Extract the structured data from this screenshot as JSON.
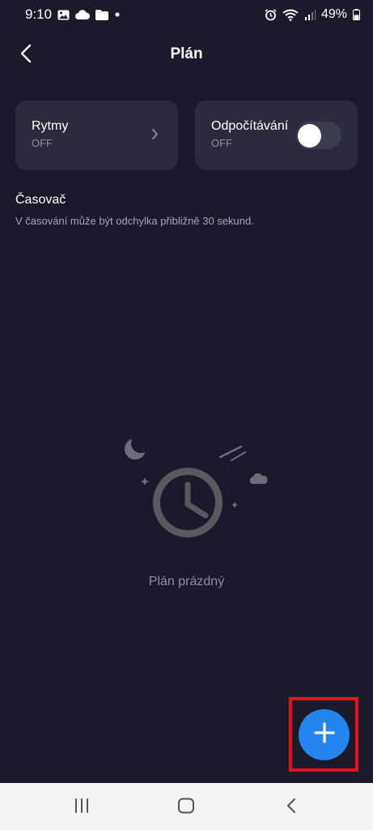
{
  "status_bar": {
    "time": "9:10",
    "battery": "49%",
    "icons_left": [
      "gallery-icon",
      "cloud-icon",
      "folder-icon",
      "dot-icon"
    ],
    "icons_right": [
      "alarm-icon",
      "wifi-icon",
      "signal-icon",
      "battery-icon"
    ]
  },
  "header": {
    "title": "Plán",
    "back_icon": "chevron-left-icon"
  },
  "cards": {
    "rhythms": {
      "title": "Rytmy",
      "status": "OFF"
    },
    "countdown": {
      "title": "Odpočítávání",
      "status": "OFF",
      "toggle_on": false
    }
  },
  "timer_section": {
    "title": "Časovač",
    "note": "V časování může být odchylka přibližně 30 sekund."
  },
  "empty_state": {
    "text": "Plán prázdný",
    "illustration": "clock-icon"
  },
  "fab": {
    "icon": "plus-icon",
    "color": "#2484f0",
    "highlight_color": "#e8101b"
  },
  "nav_bar": {
    "buttons": [
      "recents-icon",
      "home-icon",
      "back-icon"
    ]
  },
  "colors": {
    "background": "#1a1a2b",
    "card": "#2b2b3c",
    "accent": "#2484f0"
  }
}
